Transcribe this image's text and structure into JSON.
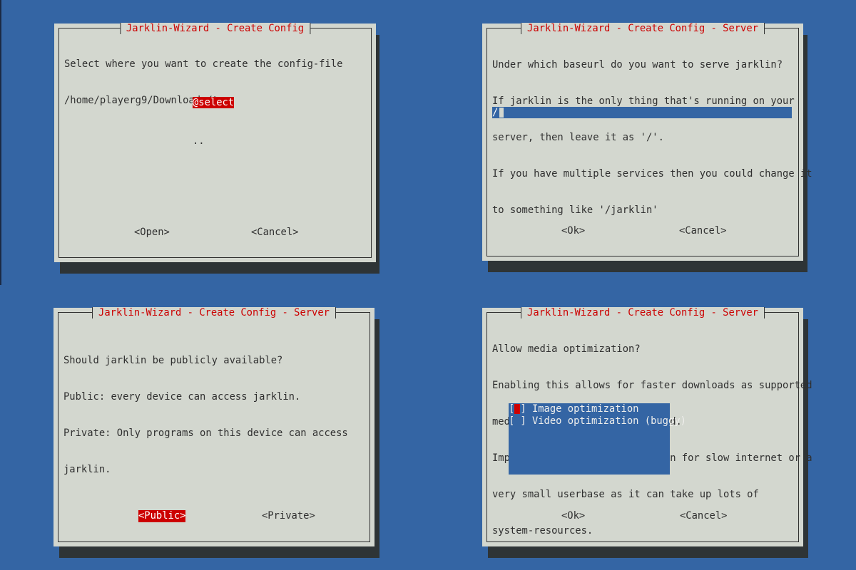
{
  "colors": {
    "desktop_bg": "#3465a4",
    "dialog_bg": "#d3d7cf",
    "title_fg": "#cc0000",
    "highlight_bg": "#cc0000",
    "field_bg": "#3465a4"
  },
  "dialog1": {
    "title": "Jarklin-Wizard - Create Config",
    "lines": [
      "Select where you want to create the config-file",
      "/home/playerg9/Downloads/tmp"
    ],
    "items": [
      "@select",
      ".."
    ],
    "selected_index": 0,
    "buttons": {
      "open": "<Open>",
      "cancel": "<Cancel>"
    }
  },
  "dialog2": {
    "title": "Jarklin-Wizard - Create Config - Server",
    "lines": [
      "Under which baseurl do you want to serve jarklin?",
      "If jarklin is the only thing that's running on your",
      "server, then leave it as '/'.",
      "If you have multiple services then you could change it",
      "to something like '/jarklin'"
    ],
    "input_value": "/",
    "buttons": {
      "ok": "<Ok>",
      "cancel": "<Cancel>"
    }
  },
  "dialog3": {
    "title": "Jarklin-Wizard - Create Config - Server",
    "lines": [
      "Should jarklin be publicly available?",
      "Public: every device can access jarklin.",
      "Private: Only programs on this device can access",
      "jarklin."
    ],
    "buttons": {
      "public": "<Public>",
      "private": "<Private>"
    },
    "focused_button": "public"
  },
  "dialog4": {
    "title": "Jarklin-Wizard - Create Config - Server",
    "lines": [
      "Allow media optimization?",
      "Enabling this allows for faster downloads as supported",
      "media is just-in-time optimized.",
      "Important: only use this option for slow internet or a",
      "very small userbase as it can take up lots of",
      "system-resources."
    ],
    "options": [
      {
        "label": "Image optimization",
        "checked": false,
        "focused": true
      },
      {
        "label": "Video optimization (buggy)",
        "checked": false,
        "focused": false
      }
    ],
    "buttons": {
      "ok": "<Ok>",
      "cancel": "<Cancel>"
    }
  }
}
